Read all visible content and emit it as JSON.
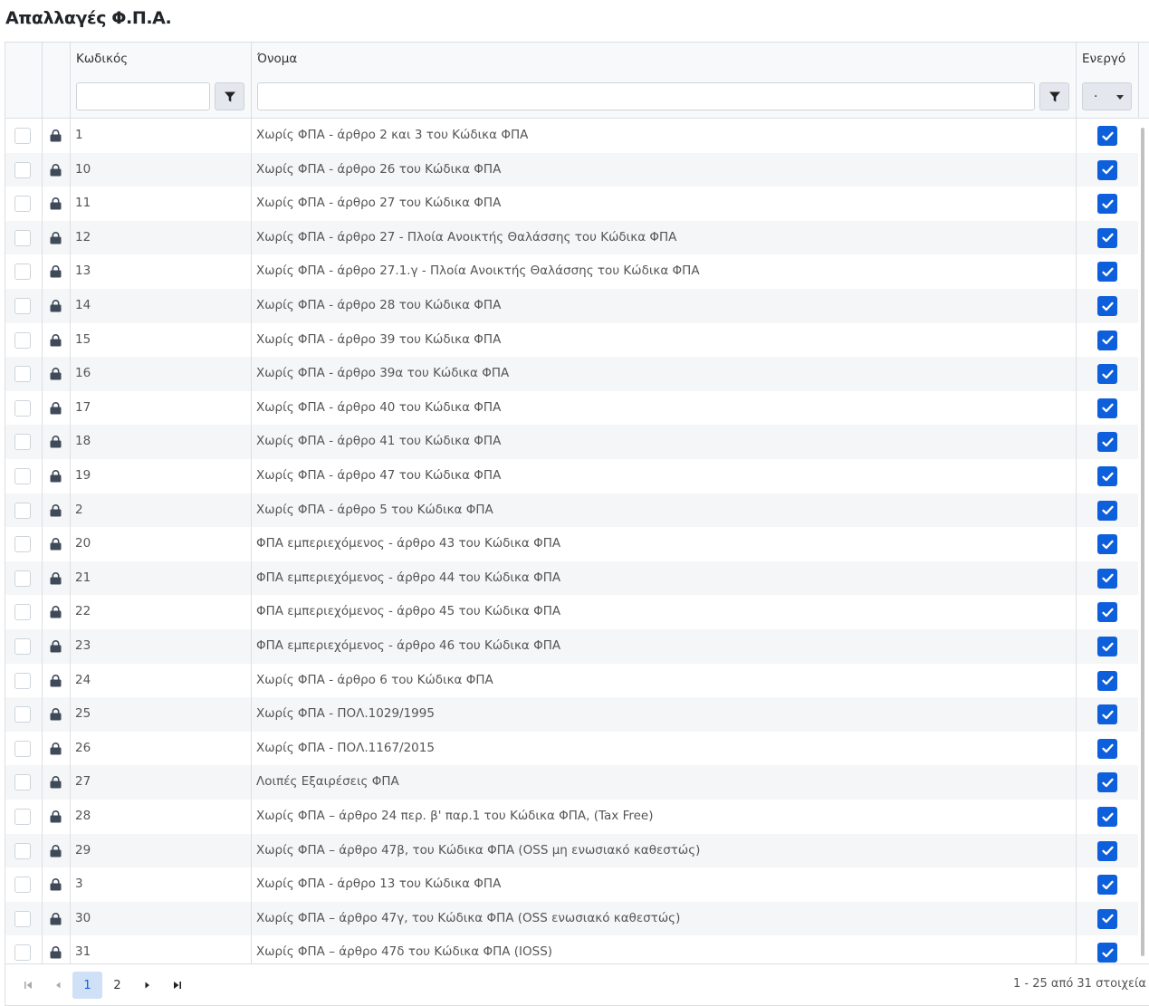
{
  "page_title": "Απαλλαγές Φ.Π.Α.",
  "columns": {
    "code": "Κωδικός",
    "name": "Όνομα",
    "active": "Ενεργό"
  },
  "filter": {
    "active_value": "."
  },
  "rows": [
    {
      "code": "1",
      "name": "Χωρίς ΦΠΑ - άρθρο 2 και 3 του Κώδικα ΦΠΑ",
      "active": true
    },
    {
      "code": "10",
      "name": "Χωρίς ΦΠΑ - άρθρο 26 του Κώδικα ΦΠΑ",
      "active": true
    },
    {
      "code": "11",
      "name": "Χωρίς ΦΠΑ - άρθρο 27 του Κώδικα ΦΠΑ",
      "active": true
    },
    {
      "code": "12",
      "name": "Χωρίς ΦΠΑ - άρθρο 27 - Πλοία Ανοικτής Θαλάσσης του Κώδικα ΦΠΑ",
      "active": true
    },
    {
      "code": "13",
      "name": "Χωρίς ΦΠΑ - άρθρο 27.1.γ - Πλοία Ανοικτής Θαλάσσης του Κώδικα ΦΠΑ",
      "active": true
    },
    {
      "code": "14",
      "name": "Χωρίς ΦΠΑ - άρθρο 28 του Κώδικα ΦΠΑ",
      "active": true
    },
    {
      "code": "15",
      "name": "Χωρίς ΦΠΑ - άρθρο 39 του Κώδικα ΦΠΑ",
      "active": true
    },
    {
      "code": "16",
      "name": "Χωρίς ΦΠΑ - άρθρο 39α του Κώδικα ΦΠΑ",
      "active": true
    },
    {
      "code": "17",
      "name": "Χωρίς ΦΠΑ - άρθρο 40 του Κώδικα ΦΠΑ",
      "active": true
    },
    {
      "code": "18",
      "name": "Χωρίς ΦΠΑ - άρθρο 41 του Κώδικα ΦΠΑ",
      "active": true
    },
    {
      "code": "19",
      "name": "Χωρίς ΦΠΑ - άρθρο 47 του Κώδικα ΦΠΑ",
      "active": true
    },
    {
      "code": "2",
      "name": "Χωρίς ΦΠΑ - άρθρο 5 του Κώδικα ΦΠΑ",
      "active": true
    },
    {
      "code": "20",
      "name": "ΦΠΑ εμπεριεχόμενος - άρθρο 43 του Κώδικα ΦΠΑ",
      "active": true
    },
    {
      "code": "21",
      "name": "ΦΠΑ εμπεριεχόμενος - άρθρο 44 του Κώδικα ΦΠΑ",
      "active": true
    },
    {
      "code": "22",
      "name": "ΦΠΑ εμπεριεχόμενος - άρθρο 45 του Κώδικα ΦΠΑ",
      "active": true
    },
    {
      "code": "23",
      "name": "ΦΠΑ εμπεριεχόμενος - άρθρο 46 του Κώδικα ΦΠΑ",
      "active": true
    },
    {
      "code": "24",
      "name": "Χωρίς ΦΠΑ - άρθρο 6 του Κώδικα ΦΠΑ",
      "active": true
    },
    {
      "code": "25",
      "name": "Χωρίς ΦΠΑ - ΠΟΛ.1029/1995",
      "active": true
    },
    {
      "code": "26",
      "name": "Χωρίς ΦΠΑ - ΠΟΛ.1167/2015",
      "active": true
    },
    {
      "code": "27",
      "name": "Λοιπές Εξαιρέσεις ΦΠΑ",
      "active": true
    },
    {
      "code": "28",
      "name": "Χωρίς ΦΠΑ – άρθρο 24 περ. β' παρ.1 του Κώδικα ΦΠΑ, (Tax Free)",
      "active": true
    },
    {
      "code": "29",
      "name": "Χωρίς ΦΠΑ – άρθρο 47β, του Κώδικα ΦΠΑ (OSS μη ενωσιακό καθεστώς)",
      "active": true
    },
    {
      "code": "3",
      "name": "Χωρίς ΦΠΑ - άρθρο 13 του Κώδικα ΦΠΑ",
      "active": true
    },
    {
      "code": "30",
      "name": "Χωρίς ΦΠΑ – άρθρο 47γ, του Κώδικα ΦΠΑ (OSS ενωσιακό καθεστώς)",
      "active": true
    },
    {
      "code": "31",
      "name": "Χωρίς ΦΠΑ – άρθρο 47δ του Κώδικα ΦΠΑ (IOSS)",
      "active": true
    }
  ],
  "pager": {
    "pages": [
      "1",
      "2"
    ],
    "current_page": "1",
    "info": "1 - 25 από 31 στοιχεία"
  },
  "colors": {
    "accent": "#0d5fdc",
    "selected_page_bg": "#cfe0f7"
  }
}
